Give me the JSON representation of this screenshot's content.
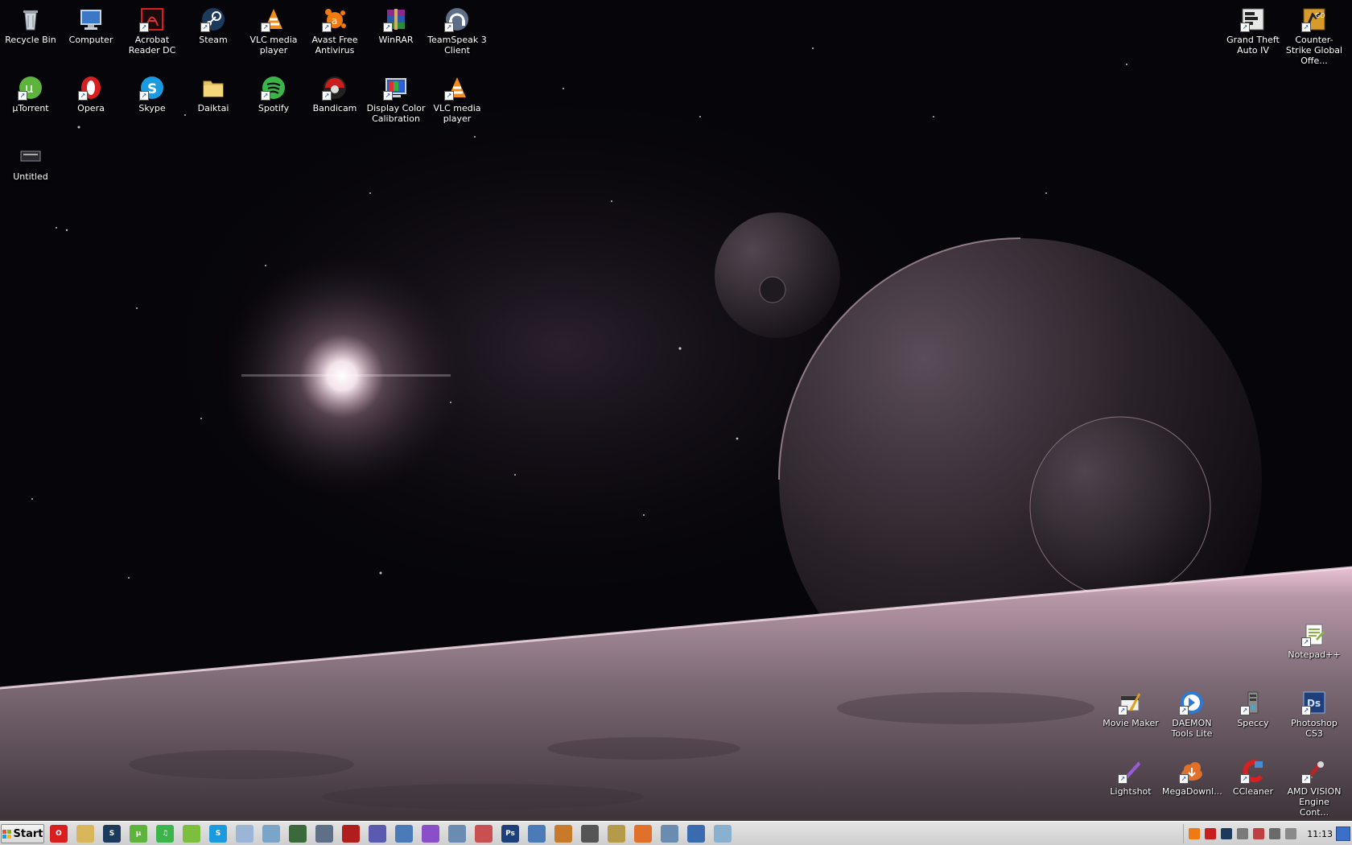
{
  "desktop": {
    "icons_top_left": [
      {
        "label": "Recycle Bin",
        "icon": "recycle-bin-icon"
      },
      {
        "label": "Computer",
        "icon": "computer-icon"
      },
      {
        "label": "Acrobat Reader DC",
        "icon": "acrobat-icon"
      },
      {
        "label": "Steam",
        "icon": "steam-icon"
      },
      {
        "label": "VLC media player",
        "icon": "vlc-icon"
      },
      {
        "label": "Avast Free Antivirus",
        "icon": "avast-icon"
      },
      {
        "label": "WinRAR",
        "icon": "winrar-icon"
      },
      {
        "label": "TeamSpeak 3 Client",
        "icon": "teamspeak-icon"
      },
      {
        "label": "µTorrent",
        "icon": "utorrent-icon"
      },
      {
        "label": "Opera",
        "icon": "opera-icon"
      },
      {
        "label": "Skype",
        "icon": "skype-icon"
      },
      {
        "label": "Daiktai",
        "icon": "folder-icon"
      },
      {
        "label": "Spotify",
        "icon": "spotify-icon"
      },
      {
        "label": "Bandicam",
        "icon": "bandicam-icon"
      },
      {
        "label": "Display Color Calibration",
        "icon": "color-calibration-icon"
      },
      {
        "label": "VLC media player",
        "icon": "vlc-icon"
      },
      {
        "label": "Untitled",
        "icon": "file-icon"
      }
    ],
    "icons_top_right": [
      {
        "label": "Grand Theft Auto IV",
        "icon": "gta-icon"
      },
      {
        "label": "Counter-Strike Global Offe...",
        "icon": "csgo-icon"
      }
    ],
    "icons_bottom_right": [
      {
        "label": "Notepad++",
        "icon": "notepadpp-icon"
      },
      {
        "label": "Movie Maker",
        "icon": "movie-maker-icon"
      },
      {
        "label": "DAEMON Tools Lite",
        "icon": "daemon-tools-icon"
      },
      {
        "label": "Speccy",
        "icon": "speccy-icon"
      },
      {
        "label": "Photoshop CS3",
        "icon": "photoshop-icon"
      },
      {
        "label": "Lightshot",
        "icon": "lightshot-icon"
      },
      {
        "label": "MegaDownl...",
        "icon": "megadownloader-icon"
      },
      {
        "label": "CCleaner",
        "icon": "ccleaner-icon"
      },
      {
        "label": "AMD VISION Engine Cont...",
        "icon": "amd-icon"
      }
    ]
  },
  "taskbar": {
    "start_label": "Start",
    "quick_launch": [
      {
        "icon": "opera-icon",
        "color": "#d81e1e",
        "glyph": "O"
      },
      {
        "icon": "folder-icon",
        "color": "#d9b65a",
        "glyph": ""
      },
      {
        "icon": "steam-icon",
        "color": "#1b3a5c",
        "glyph": "S"
      },
      {
        "icon": "utorrent-icon",
        "color": "#5db33c",
        "glyph": "µ"
      },
      {
        "icon": "spotify-icon",
        "color": "#3bb54a",
        "glyph": "♫"
      },
      {
        "icon": "messenger-icon",
        "color": "#7cbf3c",
        "glyph": ""
      },
      {
        "icon": "skype-icon",
        "color": "#1a9be0",
        "glyph": "S"
      },
      {
        "icon": "notepad-icon",
        "color": "#9ab5d6",
        "glyph": ""
      },
      {
        "icon": "color-calibration-icon",
        "color": "#7aa4c8",
        "glyph": ""
      },
      {
        "icon": "gpu-icon",
        "color": "#3a6a3a",
        "glyph": ""
      },
      {
        "icon": "teamspeak-icon",
        "color": "#5d7087",
        "glyph": ""
      },
      {
        "icon": "bandicam-icon",
        "color": "#b01d1d",
        "glyph": ""
      },
      {
        "icon": "winrar-icon",
        "color": "#5a5ab0",
        "glyph": ""
      },
      {
        "icon": "remote-desktop-icon",
        "color": "#4a7ab8",
        "glyph": ""
      },
      {
        "icon": "lightshot-icon",
        "color": "#8a4fc8",
        "glyph": ""
      },
      {
        "icon": "magnifier-icon",
        "color": "#6a8cb0",
        "glyph": ""
      },
      {
        "icon": "snipping-tool-icon",
        "color": "#c85050",
        "glyph": ""
      },
      {
        "icon": "photoshop-icon",
        "color": "#1f3f7a",
        "glyph": "Ps"
      },
      {
        "icon": "control-panel-icon",
        "color": "#4a7ab8",
        "glyph": ""
      },
      {
        "icon": "movie-maker-icon",
        "color": "#c87a2a",
        "glyph": ""
      },
      {
        "icon": "gamepad-icon",
        "color": "#555555",
        "glyph": ""
      },
      {
        "icon": "archive-icon",
        "color": "#b59a4a",
        "glyph": ""
      },
      {
        "icon": "megadownloader-icon",
        "color": "#e0702a",
        "glyph": ""
      },
      {
        "icon": "network-icon",
        "color": "#6a8cb0",
        "glyph": ""
      },
      {
        "icon": "display-icon",
        "color": "#3a6ab0",
        "glyph": ""
      },
      {
        "icon": "notes-icon",
        "color": "#8ab0d0",
        "glyph": ""
      }
    ],
    "tray_icons": [
      {
        "icon": "avast-tray-icon",
        "color": "#f07a10"
      },
      {
        "icon": "acrobat-tray-icon",
        "color": "#c81e1e"
      },
      {
        "icon": "steam-tray-icon",
        "color": "#1b3a5c"
      },
      {
        "icon": "speccy-tray-icon",
        "color": "#7a7a7a"
      },
      {
        "icon": "defender-tray-icon",
        "color": "#c04040"
      },
      {
        "icon": "network-tray-icon",
        "color": "#6a6a6a"
      },
      {
        "icon": "volume-tray-icon",
        "color": "#8a8a8a"
      }
    ],
    "clock": "11:13"
  }
}
